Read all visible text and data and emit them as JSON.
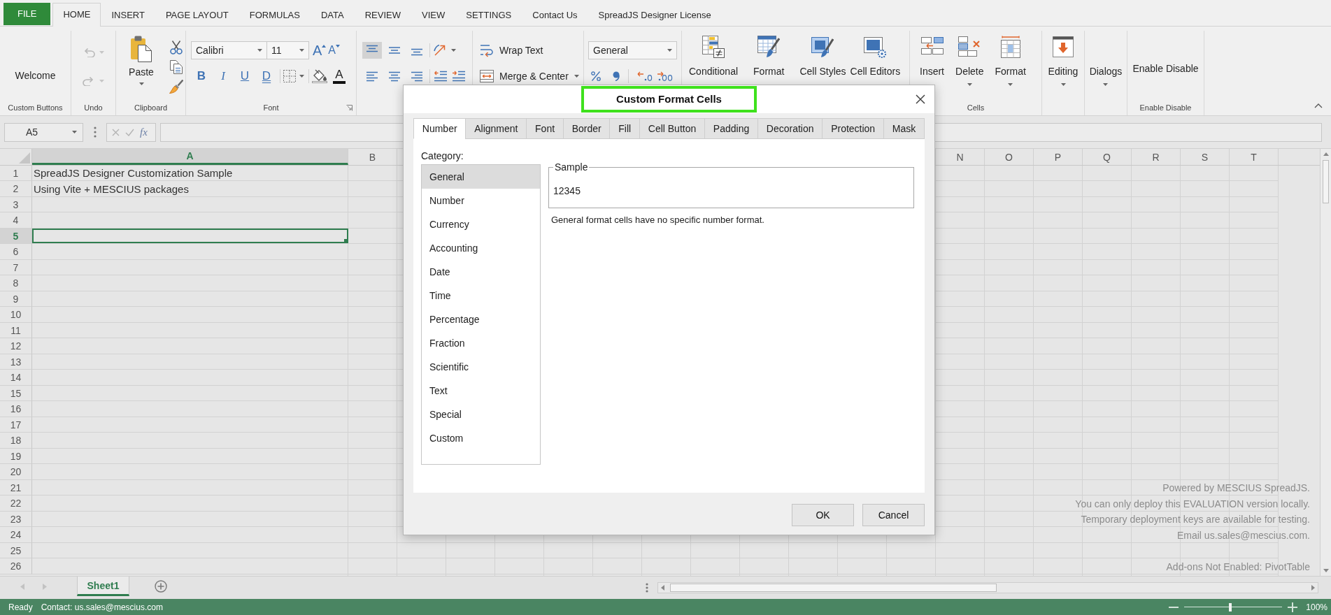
{
  "tabs": [
    {
      "label": "FILE",
      "kind": "file",
      "selected": false
    },
    {
      "label": "HOME",
      "kind": "tab",
      "selected": true
    },
    {
      "label": "INSERT",
      "kind": "tab",
      "selected": false
    },
    {
      "label": "PAGE LAYOUT",
      "kind": "tab",
      "selected": false
    },
    {
      "label": "FORMULAS",
      "kind": "tab",
      "selected": false
    },
    {
      "label": "DATA",
      "kind": "tab",
      "selected": false
    },
    {
      "label": "REVIEW",
      "kind": "tab",
      "selected": false
    },
    {
      "label": "VIEW",
      "kind": "tab",
      "selected": false
    },
    {
      "label": "SETTINGS",
      "kind": "tab",
      "selected": false
    },
    {
      "label": "Contact Us",
      "kind": "tab",
      "selected": false
    },
    {
      "label": "SpreadJS Designer License",
      "kind": "tab",
      "selected": false
    }
  ],
  "ribbon": {
    "custom_buttons": {
      "button": "Welcome",
      "label": "Custom Buttons"
    },
    "undo": {
      "undo_disabled": true,
      "redo_disabled": true,
      "label": "Undo"
    },
    "clipboard": {
      "paste": "Paste",
      "label": "Clipboard"
    },
    "font": {
      "family": "Calibri",
      "size": "11",
      "grow": "A",
      "shrink": "A",
      "bold": "B",
      "italic": "I",
      "underline": "U",
      "double_underline": "D",
      "font_color": "A",
      "label": "Font"
    },
    "alignment": {
      "vertical": [
        {
          "selected": true
        },
        {
          "selected": false
        },
        {
          "selected": false
        }
      ],
      "wrap_text": "Wrap Text",
      "merge": "Merge & Center"
    },
    "number": {
      "format": "General"
    },
    "styles": {
      "buttons": [
        "Conditional",
        "Format",
        "Cell Styles",
        "Cell Editors"
      ]
    },
    "cells": {
      "buttons": [
        {
          "label": "Insert",
          "kind": "button"
        },
        {
          "label": "Delete",
          "kind": "menu"
        },
        {
          "label": "Format",
          "kind": "menu"
        }
      ],
      "label": "Cells"
    },
    "editing": {
      "button": "Editing"
    },
    "dialogs": {
      "button": "Dialogs"
    },
    "enable_disable": {
      "button": "Enable Disable",
      "label": "Enable Disable"
    }
  },
  "formula_bar": {
    "name_box": "A5",
    "fx": "fx"
  },
  "grid": {
    "columns_left": [
      {
        "label": "A",
        "selected": true
      },
      {
        "label": "B",
        "selected": false
      }
    ],
    "columns_right": [
      {
        "label": "N",
        "selected": false
      },
      {
        "label": "O",
        "selected": false
      },
      {
        "label": "P",
        "selected": false
      },
      {
        "label": "Q",
        "selected": false
      },
      {
        "label": "R",
        "selected": false
      },
      {
        "label": "S",
        "selected": false
      },
      {
        "label": "T",
        "selected": false
      }
    ],
    "rows": [
      {
        "header": "1",
        "selected": false,
        "cells": [
          "SpreadJS Designer Customization Sample"
        ]
      },
      {
        "header": "2",
        "selected": false,
        "cells": [
          "Using Vite + MESCIUS packages"
        ]
      },
      {
        "header": "3",
        "selected": false
      },
      {
        "header": "4",
        "selected": false
      },
      {
        "header": "5",
        "selected": true
      },
      {
        "header": "6",
        "selected": false
      },
      {
        "header": "7",
        "selected": false
      },
      {
        "header": "8",
        "selected": false
      },
      {
        "header": "9",
        "selected": false
      },
      {
        "header": "10",
        "selected": false
      },
      {
        "header": "11",
        "selected": false
      },
      {
        "header": "12",
        "selected": false
      },
      {
        "header": "13",
        "selected": false
      },
      {
        "header": "14",
        "selected": false
      },
      {
        "header": "15",
        "selected": false
      },
      {
        "header": "16",
        "selected": false
      },
      {
        "header": "17",
        "selected": false
      },
      {
        "header": "18",
        "selected": false
      },
      {
        "header": "19",
        "selected": false
      },
      {
        "header": "20",
        "selected": false
      },
      {
        "header": "21",
        "selected": false
      },
      {
        "header": "22",
        "selected": false
      },
      {
        "header": "23",
        "selected": false
      },
      {
        "header": "24",
        "selected": false
      },
      {
        "header": "25",
        "selected": false
      },
      {
        "header": "26",
        "selected": false
      }
    ]
  },
  "evaluation_notice": {
    "lines": [
      "Powered by MESCIUS SpreadJS.",
      "You can only deploy this EVALUATION version locally.",
      "Temporary deployment keys are available for testing.",
      "Email us.sales@mescius.com."
    ],
    "addons": "Add-ons Not Enabled: PivotTable"
  },
  "dialog": {
    "title": "Custom Format Cells",
    "title_highlighted": true,
    "tabs": [
      {
        "label": "Number",
        "selected": true
      },
      {
        "label": "Alignment",
        "selected": false
      },
      {
        "label": "Font",
        "selected": false
      },
      {
        "label": "Border",
        "selected": false
      },
      {
        "label": "Fill",
        "selected": false
      },
      {
        "label": "Cell Button",
        "selected": false
      },
      {
        "label": "Padding",
        "selected": false
      },
      {
        "label": "Decoration",
        "selected": false
      },
      {
        "label": "Protection",
        "selected": false
      },
      {
        "label": "Mask",
        "selected": false
      }
    ],
    "category_label": "Category:",
    "categories": [
      {
        "label": "General",
        "selected": true
      },
      {
        "label": "Number",
        "selected": false
      },
      {
        "label": "Currency",
        "selected": false
      },
      {
        "label": "Accounting",
        "selected": false
      },
      {
        "label": "Date",
        "selected": false
      },
      {
        "label": "Time",
        "selected": false
      },
      {
        "label": "Percentage",
        "selected": false
      },
      {
        "label": "Fraction",
        "selected": false
      },
      {
        "label": "Scientific",
        "selected": false
      },
      {
        "label": "Text",
        "selected": false
      },
      {
        "label": "Special",
        "selected": false
      },
      {
        "label": "Custom",
        "selected": false
      }
    ],
    "sample_legend": "Sample",
    "sample_value": "12345",
    "description": "General format cells have no specific number format.",
    "buttons": [
      "OK",
      "Cancel"
    ]
  },
  "sheet_tabs": [
    {
      "label": "Sheet1",
      "selected": true
    }
  ],
  "status_bar": {
    "ready": "Ready",
    "contact": "Contact: us.sales@mescius.com",
    "zoom_slider": {
      "level": 0.47
    },
    "zoom": "100%"
  }
}
